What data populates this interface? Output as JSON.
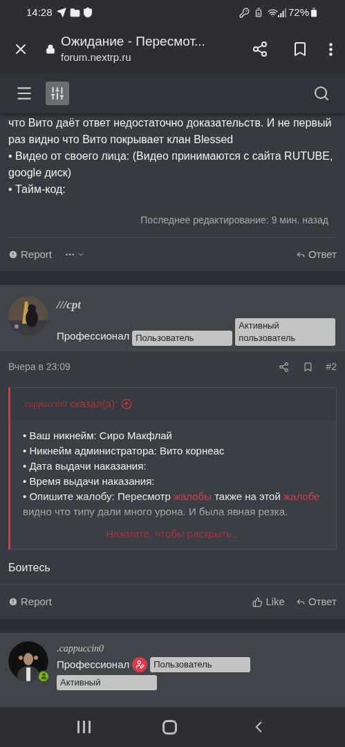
{
  "status_bar": {
    "time": "14:28",
    "battery": "72%"
  },
  "browser": {
    "title": "Ожидание - Пересмот...",
    "url": "forum.nextrp.ru"
  },
  "post_top": {
    "paragraphs": [
      "что Вито даёт ответ недостаточно доказательств. И не первый раз видно что Вито покрывает клан Blessed",
      "• Видео от своего лица: (Видео принимаются с сайта RUTUBE, google диск)",
      "• Тайм-код:"
    ],
    "edited": "Последнее редактирование: 9 мин. назад",
    "actions": {
      "report": "Report",
      "reply": "Ответ"
    }
  },
  "post_2": {
    "author": "///cpt",
    "rank": "Профессионал",
    "badges": [
      "Пользователь",
      "Активный пользователь"
    ],
    "date": "Вчера в 23:09",
    "number": "#2",
    "quote": {
      "author": ".cappuccin0",
      "said": "сказал(а):",
      "lines": [
        {
          "segments": [
            {
              "text": "• Ваш никнейм: Сиро Макфлай",
              "highlight": false
            }
          ]
        },
        {
          "segments": [
            {
              "text": "• Никнейм администратора: Вито корнеас",
              "highlight": false
            }
          ]
        },
        {
          "segments": [
            {
              "text": "• Дата выдачи наказания:",
              "highlight": false
            }
          ]
        },
        {
          "segments": [
            {
              "text": "• Время выдачи наказания:",
              "highlight": false
            }
          ]
        },
        {
          "segments": [
            {
              "text": "• Опишите жалобу: Пересмотр ",
              "highlight": false
            },
            {
              "text": "жалобы",
              "highlight": true
            },
            {
              "text": " также на этой ",
              "highlight": false
            },
            {
              "text": "жалобе",
              "highlight": true
            },
            {
              "text": " видно что типу дали много урона. И была явная резка.",
              "highlight": false
            }
          ]
        }
      ],
      "expand": "Нажмите, чтобы раскрыть..."
    },
    "body": "Боитесь",
    "actions": {
      "report": "Report",
      "like": "Like",
      "reply": "Ответ"
    }
  },
  "post_3": {
    "author": ".cappuccin0",
    "rank": "Профессионал",
    "online": true,
    "badges": [
      "Пользователь",
      "Активный"
    ]
  }
}
